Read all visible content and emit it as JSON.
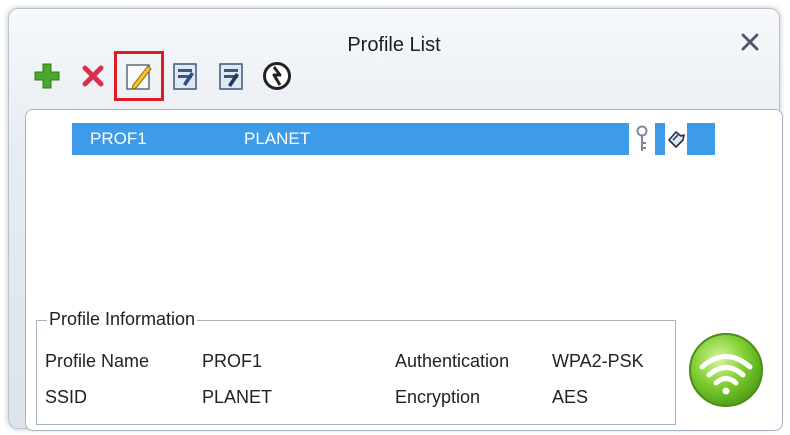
{
  "window": {
    "title": "Profile List"
  },
  "profiles": [
    {
      "name": "PROF1",
      "ssid": "PLANET"
    }
  ],
  "profile_info": {
    "legend": "Profile Information",
    "profile_name_label": "Profile Name",
    "profile_name_value": "PROF1",
    "ssid_label": "SSID",
    "ssid_value": "PLANET",
    "authentication_label": "Authentication",
    "authentication_value": "WPA2-PSK",
    "encryption_label": "Encryption",
    "encryption_value": "AES"
  },
  "colors": {
    "selected_row": "#3d9bea",
    "highlight_box": "#e01b24",
    "connect_green": "#7ccc2d"
  },
  "icons": [
    "add-icon",
    "delete-icon",
    "edit-icon",
    "import-icon",
    "export-icon",
    "scan-icon",
    "close-icon",
    "key-icon",
    "connected-hand-icon",
    "wifi-signal-icon"
  ]
}
